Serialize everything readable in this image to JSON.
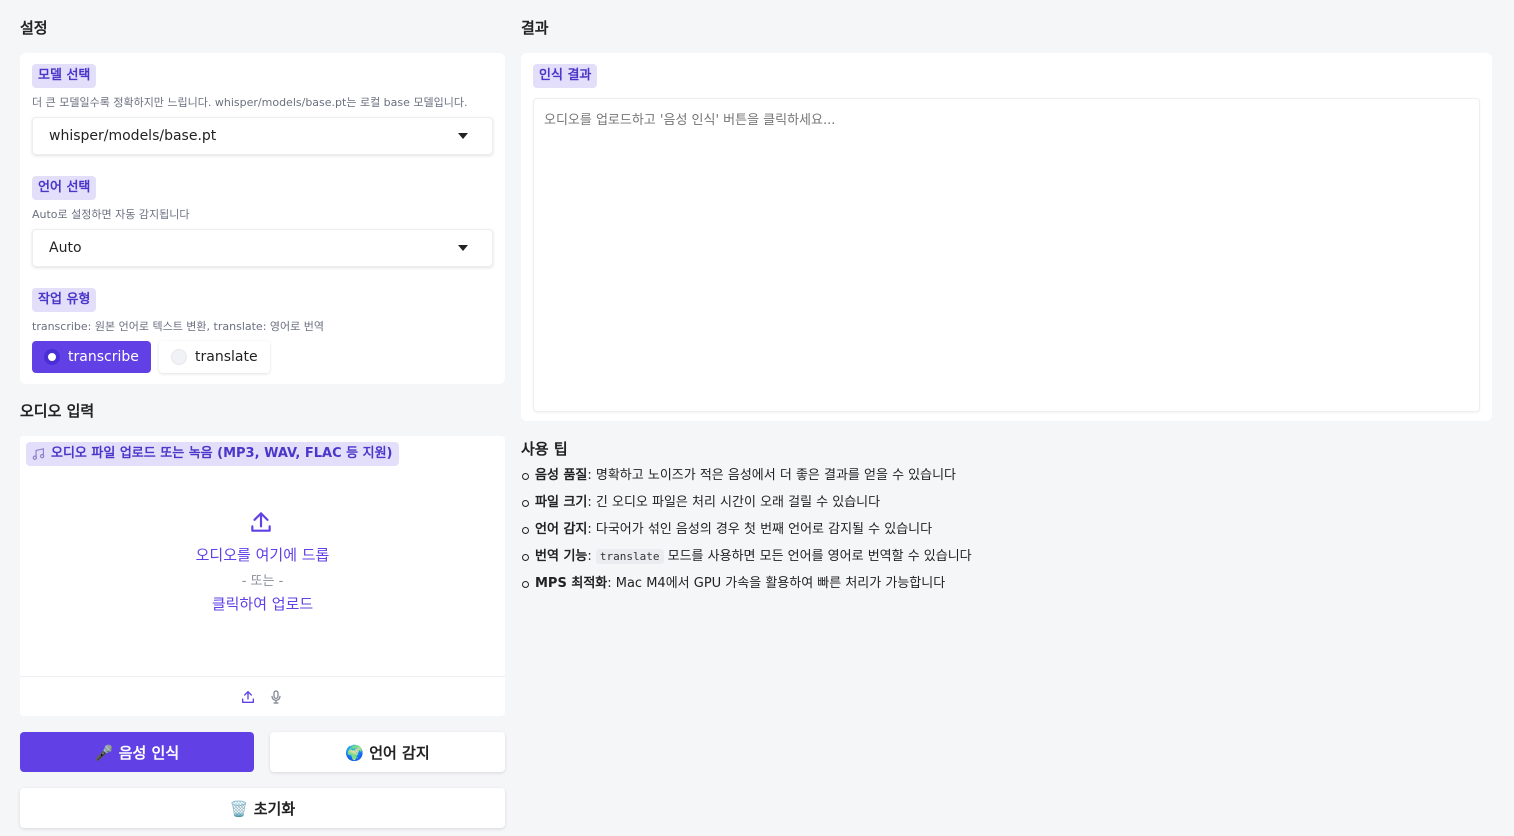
{
  "settings": {
    "title": "설정",
    "model": {
      "label": "모델 선택",
      "hint": "더 큰 모델일수록 정확하지만 느립니다. whisper/models/base.pt는 로컬 base 모델입니다.",
      "value": "whisper/models/base.pt"
    },
    "language": {
      "label": "언어 선택",
      "hint": "Auto로 설정하면 자동 감지됩니다",
      "value": "Auto"
    },
    "task": {
      "label": "작업 유형",
      "hint": "transcribe: 원본 언어로 텍스트 변환, translate: 영어로 번역",
      "options": [
        "transcribe",
        "translate"
      ],
      "selected": "transcribe"
    }
  },
  "audio": {
    "title": "오디오 입력",
    "label": "오디오 파일 업로드 또는 녹음 (MP3, WAV, FLAC 등 지원)",
    "drop_text": "오디오를 여기에 드롭",
    "or_text": "- 또는 -",
    "click_text": "클릭하여 업로드"
  },
  "buttons": {
    "recognize": "🎤 음성 인식",
    "detect": "🌍 언어 감지",
    "reset": "🗑️ 초기화"
  },
  "result": {
    "title": "결과",
    "label": "인식 결과",
    "placeholder": "오디오를 업로드하고 '음성 인식' 버튼을 클릭하세요..."
  },
  "tips": {
    "title": "사용 팁",
    "items": [
      {
        "bold": "음성 품질",
        "pre": ": 명확하고 노이즈가 적은 음성에서 더 좋은 결과를 얻을 수 있습니다",
        "code": "",
        "post": ""
      },
      {
        "bold": "파일 크기",
        "pre": ": 긴 오디오 파일은 처리 시간이 오래 걸릴 수 있습니다",
        "code": "",
        "post": ""
      },
      {
        "bold": "언어 감지",
        "pre": ": 다국어가 섞인 음성의 경우 첫 번째 언어로 감지될 수 있습니다",
        "code": "",
        "post": ""
      },
      {
        "bold": "번역 기능",
        "pre": ": ",
        "code": "translate",
        "post": " 모드를 사용하면 모든 언어를 영어로 번역할 수 있습니다"
      },
      {
        "bold": "MPS 최적화",
        "pre": ": Mac M4에서 GPU 가속을 활용하여 빠른 처리가 가능합니다",
        "code": "",
        "post": ""
      }
    ]
  },
  "colors": {
    "accent": "#6141e6",
    "badge_bg": "#e3dffb",
    "badge_text": "#4a36c8",
    "background": "#f5f6f8"
  }
}
